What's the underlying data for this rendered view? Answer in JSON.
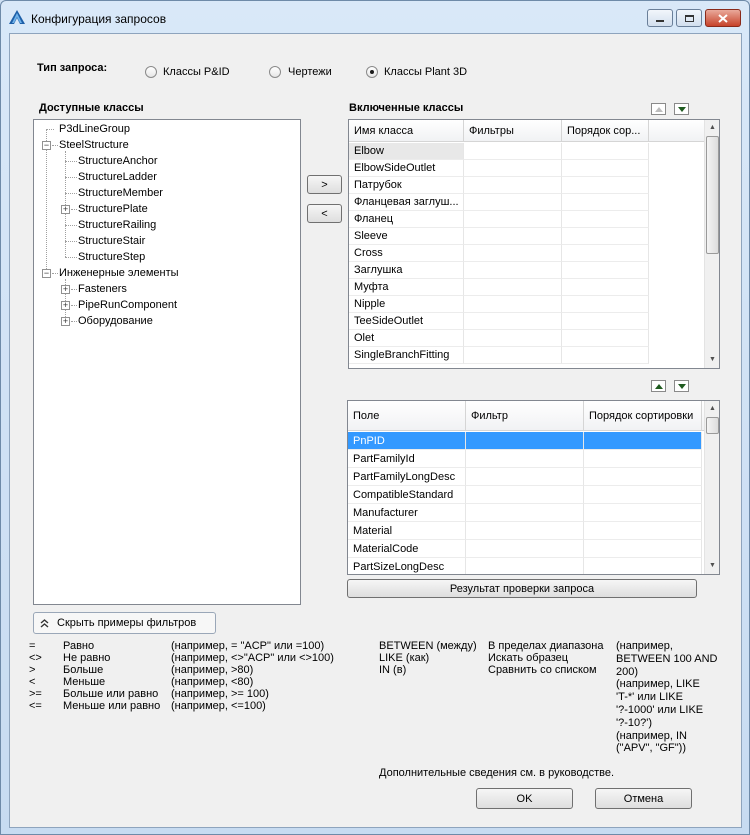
{
  "window": {
    "title": "Конфигурация запросов"
  },
  "query_type": {
    "label": "Тип запроса:",
    "options": [
      {
        "label": "Классы P&ID",
        "selected": false
      },
      {
        "label": "Чертежи",
        "selected": false
      },
      {
        "label": "Классы Plant 3D",
        "selected": true
      }
    ]
  },
  "available": {
    "title": "Доступные классы",
    "tree": [
      {
        "label": "P3dLineGroup"
      },
      {
        "label": "SteelStructure"
      },
      {
        "label": "StructureAnchor"
      },
      {
        "label": "StructureLadder"
      },
      {
        "label": "StructureMember"
      },
      {
        "label": "StructurePlate"
      },
      {
        "label": "StructureRailing"
      },
      {
        "label": "StructureStair"
      },
      {
        "label": "StructureStep"
      },
      {
        "label": "Инженерные элементы"
      },
      {
        "label": "Fasteners"
      },
      {
        "label": "PipeRunComponent"
      },
      {
        "label": "Оборудование"
      }
    ]
  },
  "move_buttons": {
    "add": ">",
    "remove": "<"
  },
  "included": {
    "title": "Включенные классы",
    "columns": [
      "Имя класса",
      "Фильтры",
      "Порядок сор..."
    ],
    "rows": [
      "Elbow",
      "ElbowSideOutlet",
      "Патрубок",
      "Фланцевая заглуш...",
      "Фланец",
      "Sleeve",
      "Cross",
      "Заглушка",
      "Муфта",
      "Nipple",
      "TeeSideOutlet",
      "Olet",
      "SingleBranchFitting"
    ]
  },
  "fields": {
    "columns": [
      "Поле",
      "Фильтр",
      "Порядок сортировки"
    ],
    "rows": [
      "PnPID",
      "PartFamilyId",
      "PartFamilyLongDesc",
      "CompatibleStandard",
      "Manufacturer",
      "Material",
      "MaterialCode",
      "PartSizeLongDesc"
    ]
  },
  "validate_button": "Результат проверки запроса",
  "hide_examples_button": "Скрыть примеры фильтров",
  "operators": [
    {
      "op": "=",
      "name": "Равно",
      "example": "(например, = \"ACP\" или =100)"
    },
    {
      "op": "<>",
      "name": "Не равно",
      "example": "(например, <>\"ACP\" или <>100)"
    },
    {
      "op": ">",
      "name": "Больше",
      "example": "(например, >80)"
    },
    {
      "op": "<",
      "name": "Меньше",
      "example": "(например, <80)"
    },
    {
      "op": ">=",
      "name": "Больше или равно",
      "example": "(например, >= 100)"
    },
    {
      "op": "<=",
      "name": "Меньше или равно",
      "example": "(например, <=100)"
    }
  ],
  "keywords": [
    {
      "kw": "BETWEEN (между)",
      "name": "В пределах диапазона"
    },
    {
      "kw": "LIKE (как)",
      "name": "Искать образец"
    },
    {
      "kw": "IN (в)",
      "name": "Сравнить со списком"
    }
  ],
  "keyword_examples": [
    "(например,",
    "BETWEEN 100 AND",
    "200)",
    "(например, LIKE",
    "'T-*' или LIKE",
    "'?-1000' или LIKE",
    "'?-10?')",
    "(например, IN",
    "(\"APV\", \"GF\"))"
  ],
  "more_info": "Дополнительные сведения см. в руководстве.",
  "ok_button": "OK",
  "cancel_button": "Отмена"
}
